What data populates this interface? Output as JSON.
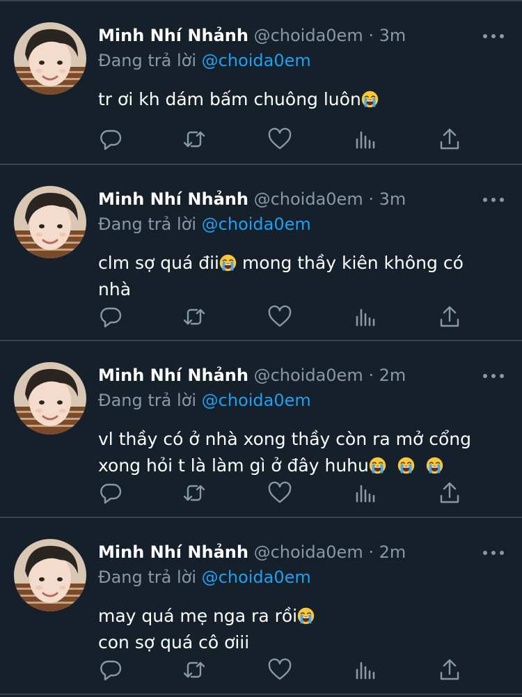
{
  "colors": {
    "background": "#15202b",
    "divider": "#38444d",
    "secondary_text": "#8899a6",
    "mention": "#1da1f2",
    "emoji_face": "#fbc83b",
    "emoji_tears": "#3ea9f5"
  },
  "icons": {
    "more": "more-horizontal-icon",
    "reply": "reply-icon",
    "retweet": "retweet-icon",
    "like": "heart-icon",
    "analytics": "analytics-icon",
    "share": "share-icon",
    "emoji": "loudly-crying-face-emoji"
  },
  "tweets": [
    {
      "display_name": "Minh Nhí Nhảnh",
      "handle": "@choida0em",
      "separator": "·",
      "time": "3m",
      "reply_prefix": "Đang trả lời",
      "reply_to": "@choida0em",
      "lines": [
        "tr ơi kh dám bấm chuông luôn"
      ]
    },
    {
      "display_name": "Minh Nhí Nhảnh",
      "handle": "@choida0em",
      "separator": "·",
      "time": "3m",
      "reply_prefix": "Đang trả lời",
      "reply_to": "@choida0em",
      "lines": [
        "clm sợ quá đii",
        " mong thầy kiên không có",
        "nhà"
      ]
    },
    {
      "display_name": "Minh Nhí Nhảnh",
      "handle": "@choida0em",
      "separator": "·",
      "time": "2m",
      "reply_prefix": "Đang trả lời",
      "reply_to": "@choida0em",
      "lines": [
        "vl thầy có ở nhà xong thầy còn ra mở cổng",
        "xong hỏi t là làm gì ở đây huhu"
      ]
    },
    {
      "display_name": "Minh Nhí Nhảnh",
      "handle": "@choida0em",
      "separator": "·",
      "time": "2m",
      "reply_prefix": "Đang trả lời",
      "reply_to": "@choida0em",
      "lines": [
        "may quá mẹ nga ra rồi",
        "con sợ quá cô ơiii"
      ]
    }
  ]
}
